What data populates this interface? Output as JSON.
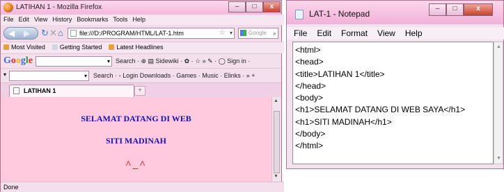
{
  "firefox": {
    "title": "LATIHAN 1 - Mozilla Firefox",
    "menu": [
      "File",
      "Edit",
      "View",
      "History",
      "Bookmarks",
      "Tools",
      "Help"
    ],
    "url": "file:///D:/PROGRAM/HTML/LAT-1.htm",
    "search_placeholder": "Google",
    "bookmarks": [
      "Most Visited",
      "Getting Started",
      "Latest Headlines"
    ],
    "google_toolbar": {
      "logo": "Google",
      "items": "Search · ⊕ ▤ Sidewiki · ✿ · ☆ » ✎ · ◯ Sign in ·"
    },
    "toolbar2": {
      "items": "Search · ◦ Login  Downloads · Games · Music · Elinks · »  +"
    },
    "tab_label": "LATIHAN 1",
    "new_tab": "+",
    "page": {
      "heading1": "SELAMAT DATANG DI WEB",
      "heading2": "SITI MADINAH",
      "face": "^_^"
    },
    "status": "Done"
  },
  "notepad": {
    "title": "LAT-1 - Notepad",
    "menu": [
      "File",
      "Edit",
      "Format",
      "View",
      "Help"
    ],
    "lines": [
      "<html>",
      "<head>",
      "<title>LATIHAN 1</title>",
      "</head>",
      "<body>",
      "<h1>SELAMAT DATANG DI WEB SAYA</h1>",
      "<h1>SITI MADINAH</h1>",
      "</body>",
      "</html>"
    ]
  }
}
